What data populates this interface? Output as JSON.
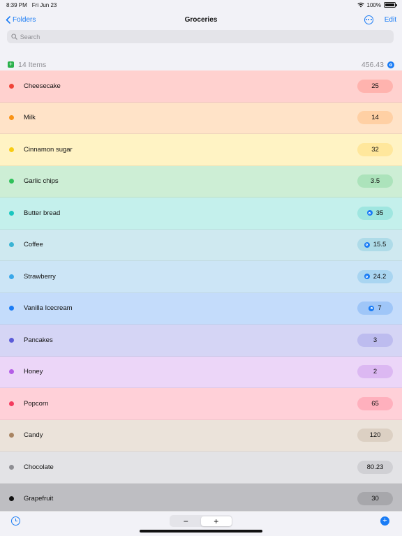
{
  "status": {
    "time": "8:39 PM",
    "date": "Fri Jun 23",
    "battery": "100%",
    "battery_level": 1.0
  },
  "nav": {
    "back_label": "Folders",
    "title": "Groceries",
    "edit_label": "Edit"
  },
  "search": {
    "placeholder": "Search"
  },
  "summary": {
    "count_label": "14 Items",
    "total": "456.43"
  },
  "items": [
    {
      "name": "Cheesecake",
      "value": "25",
      "dot": "#f04438",
      "bg": "#ffd1cf",
      "pill": "#ffb3ae",
      "icon": false
    },
    {
      "name": "Milk",
      "value": "14",
      "dot": "#f99316",
      "bg": "#ffe3c8",
      "pill": "#ffd0a4",
      "icon": false
    },
    {
      "name": "Cinnamon sugar",
      "value": "32",
      "dot": "#f8cc12",
      "bg": "#fff3c4",
      "pill": "#ffe79c",
      "icon": false
    },
    {
      "name": "Garlic chips",
      "value": "3.5",
      "dot": "#30c15a",
      "bg": "#cdeed5",
      "pill": "#ace3bb",
      "icon": false
    },
    {
      "name": "Butter bread",
      "value": "35",
      "dot": "#18c7c0",
      "bg": "#c4f0ec",
      "pill": "#9fe6e0",
      "icon": true
    },
    {
      "name": "Coffee",
      "value": "15.5",
      "dot": "#3ab4d4",
      "bg": "#cfe9f0",
      "pill": "#aedbe8",
      "icon": true
    },
    {
      "name": "Strawberry",
      "value": "24.2",
      "dot": "#3aa8ea",
      "bg": "#cce5f6",
      "pill": "#a9d5f1",
      "icon": true
    },
    {
      "name": "Vanilla Icecream",
      "value": "7",
      "dot": "#1a7cf5",
      "bg": "#c4dcfb",
      "pill": "#9fc6f8",
      "icon": true
    },
    {
      "name": "Pancakes",
      "value": "3",
      "dot": "#5b5bd8",
      "bg": "#d5d5f5",
      "pill": "#bdbcef",
      "icon": false
    },
    {
      "name": "Honey",
      "value": "2",
      "dot": "#b45de6",
      "bg": "#ecd6f8",
      "pill": "#dcb8f2",
      "icon": false
    },
    {
      "name": "Popcorn",
      "value": "65",
      "dot": "#f43a5e",
      "bg": "#ffd0d8",
      "pill": "#ffb0bd",
      "icon": false
    },
    {
      "name": "Candy",
      "value": "120",
      "dot": "#a88462",
      "bg": "#ebe3da",
      "pill": "#dcd0c3",
      "icon": false
    },
    {
      "name": "Chocolate",
      "value": "80.23",
      "dot": "#8e8e93",
      "bg": "#e3e3e6",
      "pill": "#d0d0d4",
      "icon": false
    },
    {
      "name": "Grapefruit",
      "value": "30",
      "dot": "#111111",
      "bg": "#bebec2",
      "pill": "#a7a7ab",
      "icon": false
    }
  ],
  "toolbar": {
    "minus_label": "−",
    "plus_label": "+",
    "add_label": "+"
  },
  "colors": {
    "accent": "#1a7cf5",
    "add_green": "#2bb14c"
  }
}
